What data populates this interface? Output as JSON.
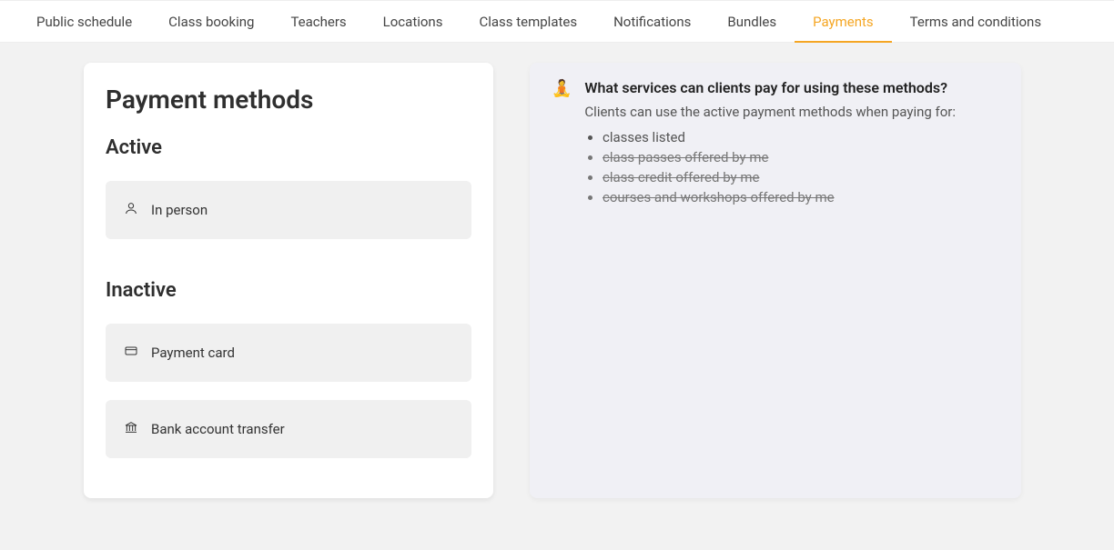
{
  "tabs": [
    {
      "label": "Public schedule",
      "active": false
    },
    {
      "label": "Class booking",
      "active": false
    },
    {
      "label": "Teachers",
      "active": false
    },
    {
      "label": "Locations",
      "active": false
    },
    {
      "label": "Class templates",
      "active": false
    },
    {
      "label": "Notifications",
      "active": false
    },
    {
      "label": "Bundles",
      "active": false
    },
    {
      "label": "Payments",
      "active": true
    },
    {
      "label": "Terms and conditions",
      "active": false
    }
  ],
  "main": {
    "title": "Payment methods",
    "active_heading": "Active",
    "inactive_heading": "Inactive",
    "active_methods": [
      {
        "icon": "person",
        "label": "In person"
      }
    ],
    "inactive_methods": [
      {
        "icon": "card",
        "label": "Payment card"
      },
      {
        "icon": "bank",
        "label": "Bank account transfer"
      }
    ]
  },
  "info": {
    "emoji": "🧘",
    "title": "What services can clients pay for using these methods?",
    "subtitle": "Clients can use the active payment methods when paying for:",
    "items": [
      {
        "text": "classes listed",
        "strike": false
      },
      {
        "text": "class passes offered by me",
        "strike": true
      },
      {
        "text": "class credit offered by me",
        "strike": true
      },
      {
        "text": "courses and workshops offered by me",
        "strike": true
      }
    ]
  }
}
